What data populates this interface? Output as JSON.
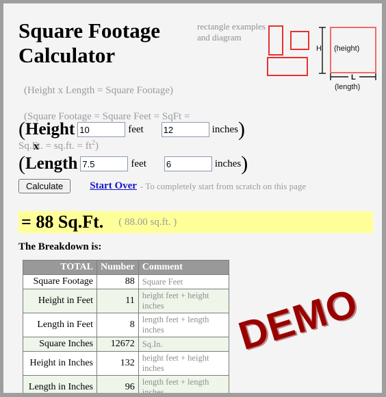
{
  "page": {
    "title": "Square Footage Calculator",
    "title_line1": "Square Footage",
    "title_line2": "Calculator",
    "subtitle_line1": "(Height x Length = Square Footage)",
    "subtitle_line2": "(Square Footage = Square Feet = SqFt =",
    "subtitle_line3_pre": "Sq.Ft. = sq.ft. = ft",
    "subtitle_line3_sup": "2",
    "subtitle_line3_post": ")",
    "background_color": "#f4f4f4",
    "border_color": "#9e9e9e"
  },
  "diagram": {
    "caption": "rectangle examples and diagram",
    "caption_line1": "rectangle examples",
    "caption_line2": "and diagram",
    "example_rect_color": "#e83030",
    "main_rect_color": "#ef6a6a",
    "h_label": "H",
    "height_word": "(height)",
    "l_label": "L",
    "length_word": "(length)"
  },
  "form": {
    "height": {
      "open_paren": "(",
      "label": "Height",
      "feet_value": "10",
      "feet_unit": "feet",
      "inches_value": "12",
      "inches_unit": "inches",
      "close_paren": ")"
    },
    "multiply_symbol": "x",
    "length": {
      "open_paren": "(",
      "label": "Length",
      "feet_value": "7.5",
      "feet_unit": "feet",
      "inches_value": "6",
      "inches_unit": "inches",
      "close_paren": ")"
    },
    "calculate_label": "Calculate",
    "start_over_label": "Start Over",
    "start_over_note": "- To completely start from scratch on this page"
  },
  "result": {
    "main": "= 88 Sq.Ft.",
    "alternate": "( 88.00 sq.ft. )",
    "banner_color": "#ffff99",
    "breakdown_heading": "The Breakdown is:"
  },
  "table": {
    "headers": [
      "TOTAL",
      "Number",
      "Comment"
    ],
    "header_bg": "#999999",
    "alt_row_bg": "#eef5e9",
    "rows": [
      {
        "label": "Square Footage",
        "number": "88",
        "comment": "Square Feet"
      },
      {
        "label": "Height in Feet",
        "number": "11",
        "comment": "height feet + height inches"
      },
      {
        "label": "Length in Feet",
        "number": "8",
        "comment": "length feet + length inches"
      },
      {
        "label": "Square Inches",
        "number": "12672",
        "comment": "Sq.In."
      },
      {
        "label": "Height in Inches",
        "number": "132",
        "comment": "height feet + height inches"
      },
      {
        "label": "Length in Inches",
        "number": "96",
        "comment": "length feet + length inches"
      }
    ]
  },
  "watermark": {
    "text": "DEMO",
    "color": "#990000"
  }
}
